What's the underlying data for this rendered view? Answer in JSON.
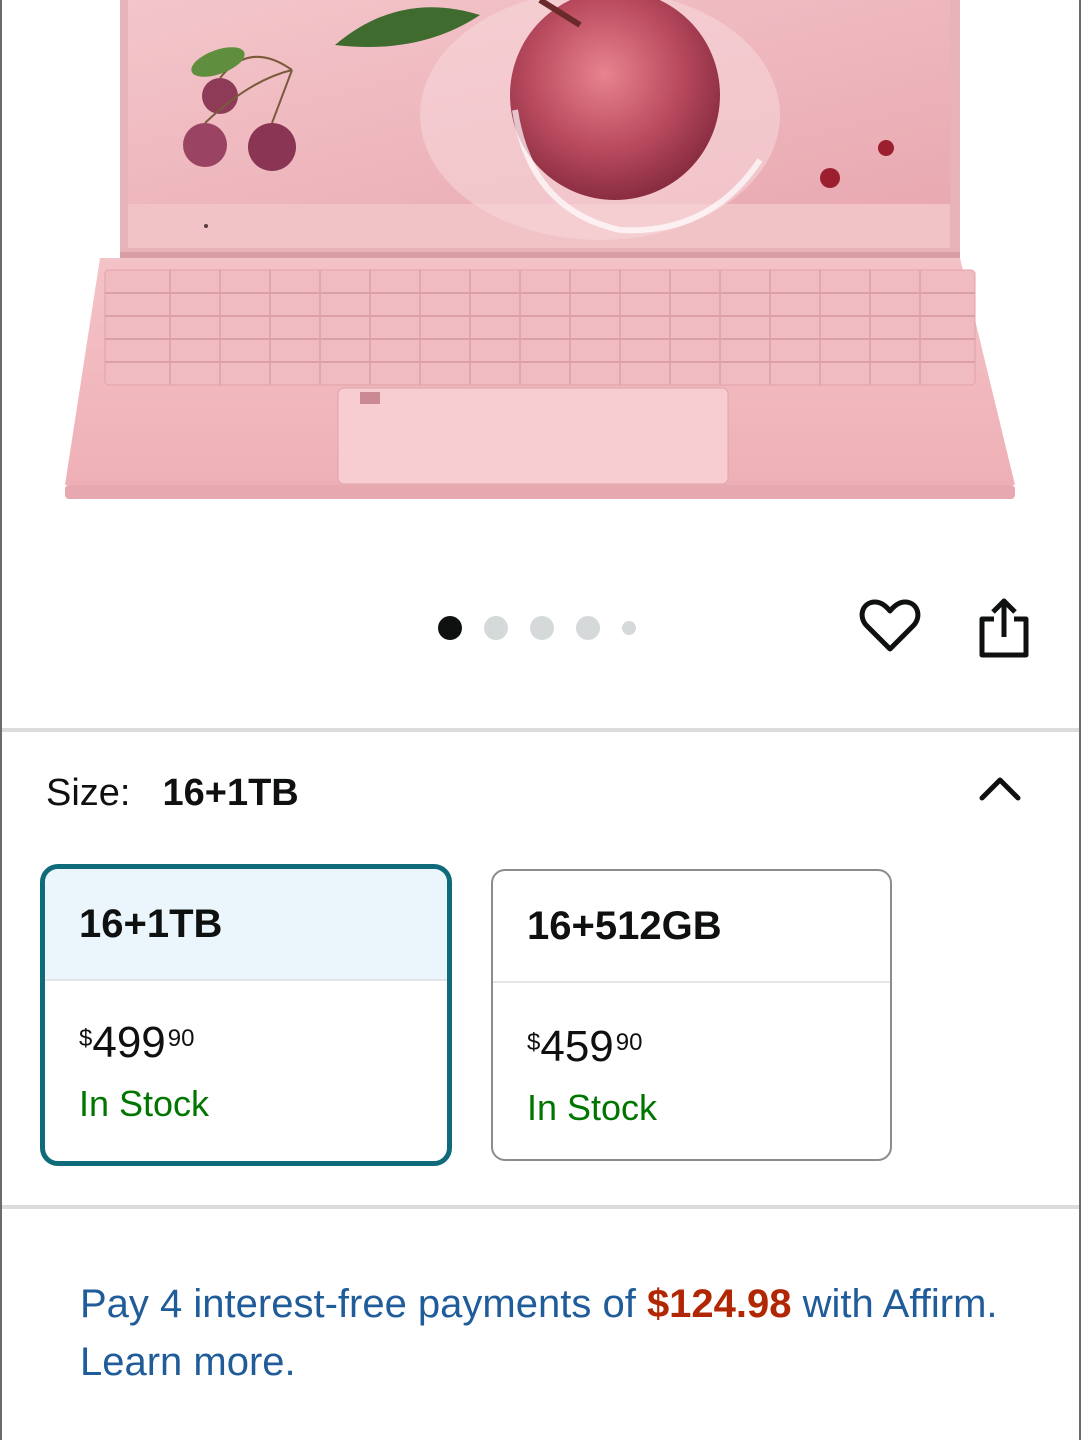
{
  "carousel": {
    "slide_count": 5,
    "active_index": 0
  },
  "size_selector": {
    "label": "Size:",
    "selected_value": "16+1TB",
    "options": [
      {
        "name": "16+1TB",
        "price_symbol": "$",
        "price_whole": "499",
        "price_fraction": "90",
        "availability": "In Stock",
        "selected": true
      },
      {
        "name": "16+512GB",
        "price_symbol": "$",
        "price_whole": "459",
        "price_fraction": "90",
        "availability": "In Stock",
        "selected": false
      }
    ]
  },
  "affirm": {
    "text_before": "Pay 4 interest-free payments of ",
    "amount": "$124.98",
    "text_after": " with Affirm. Learn more."
  },
  "icons": {
    "wishlist": "heart-icon",
    "share": "share-icon",
    "collapse": "chevron-up-icon"
  },
  "colors": {
    "selected_border": "#0f6b7a",
    "selected_header_bg": "#eaf6fc",
    "stock_green": "#007600",
    "affirm_blue": "#1f5c99",
    "price_red": "#b12704",
    "laptop_pink": "#f0b7bd"
  }
}
